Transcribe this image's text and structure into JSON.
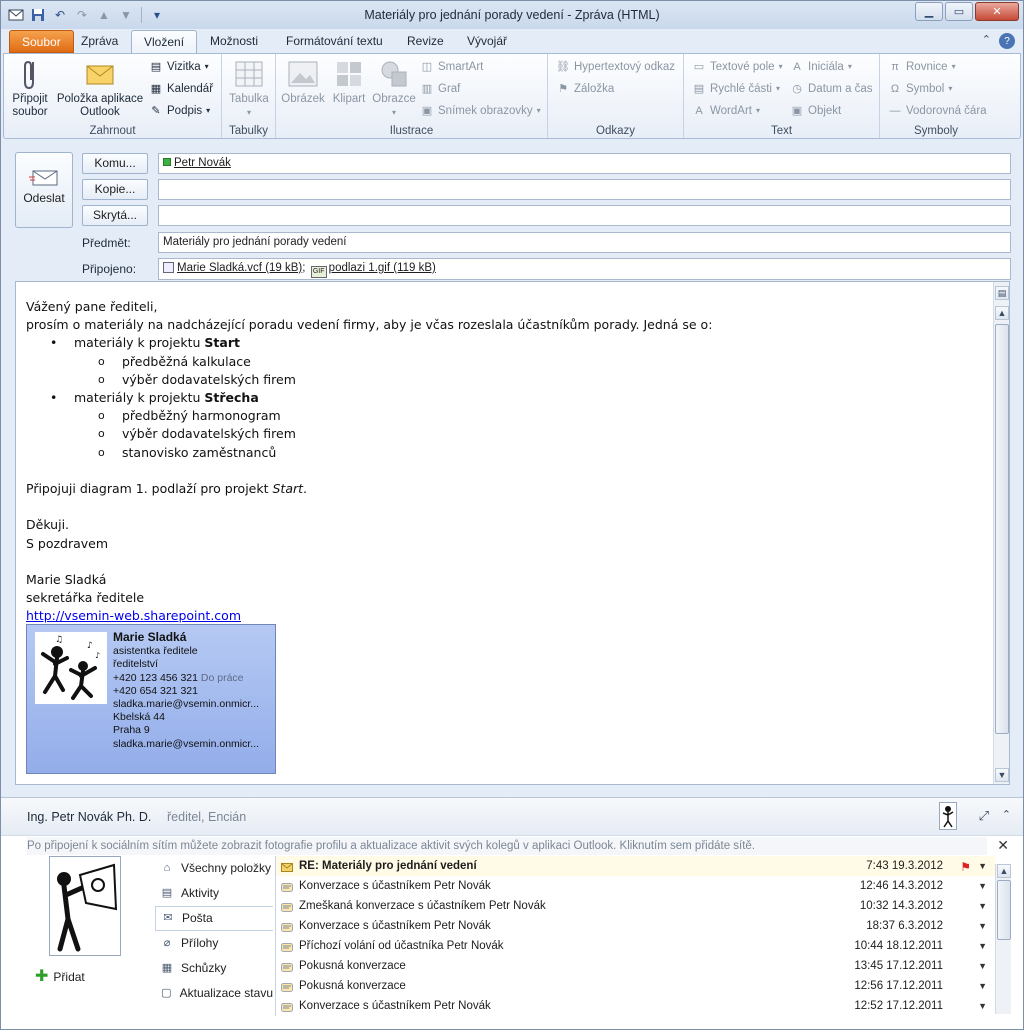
{
  "window": {
    "title": "Materiály pro jednání porady vedení  -  Zpráva (HTML)"
  },
  "tabs": [
    {
      "label": "Soubor"
    },
    {
      "label": "Zpráva"
    },
    {
      "label": "Vložení"
    },
    {
      "label": "Možnosti"
    },
    {
      "label": "Formátování textu"
    },
    {
      "label": "Revize"
    },
    {
      "label": "Vývojář"
    }
  ],
  "ribbon": {
    "zahrnout": {
      "label": "Zahrnout",
      "pripojit": "Připojit soubor",
      "polozka": "Položka aplikace Outlook",
      "vizitka": "Vizitka",
      "kalendar": "Kalendář",
      "podpis": "Podpis"
    },
    "tabulky": {
      "label": "Tabulky",
      "tabulka": "Tabulka"
    },
    "ilustrace": {
      "label": "Ilustrace",
      "obrazek": "Obrázek",
      "klipart": "Klipart",
      "obrazce": "Obrazce",
      "smartart": "SmartArt",
      "graf": "Graf",
      "snimek": "Snímek obrazovky"
    },
    "odkazy": {
      "label": "Odkazy",
      "hypertext": "Hypertextový odkaz",
      "zalozka": "Záložka"
    },
    "text": {
      "label": "Text",
      "textove_pole": "Textové pole",
      "rychle_casti": "Rychlé části",
      "wordart": "WordArt",
      "iniciala": "Iniciála",
      "datum": "Datum a čas",
      "objekt": "Objekt"
    },
    "symboly": {
      "label": "Symboly",
      "rovnice": "Rovnice",
      "symbol": "Symbol",
      "cara": "Vodorovná čára"
    }
  },
  "compose": {
    "send": "Odeslat",
    "to_btn": "Komu...",
    "cc_btn": "Kopie...",
    "bcc_btn": "Skrytá...",
    "to_value": "Petr Novák",
    "cc_value": "",
    "bcc_value": "",
    "subject_label": "Předmět:",
    "subject_value": "Materiály pro jednání porady vedení",
    "attached_label": "Připojeno:",
    "attachment1": "Marie Sladká.vcf (19 kB)",
    "attachment_sep": ";",
    "attachment2": "podlazi 1.gif (119 kB)"
  },
  "message": {
    "greeting": "Vážený pane řediteli,",
    "intro": "prosím o materiály na nadcházející poradu vedení firmy, aby je včas rozeslala účastníkům porady. Jedná se o:",
    "item1_prefix": "materiály k projektu ",
    "item1_bold": "Start",
    "item1_sub": [
      "předběžná kalkulace",
      "výběr dodavatelských firem"
    ],
    "item2_prefix": "materiály k projektu ",
    "item2_bold": "Střecha",
    "item2_sub": [
      "předběžný harmonogram",
      "výběr dodavatelských firem",
      "stanovisko zaměstnanců"
    ],
    "diagram_prefix": "Připojuji diagram 1. podlaží pro projekt ",
    "diagram_italic": "Start",
    "diagram_suffix": ".",
    "thanks": "Děkuji.",
    "regards": "S pozdravem",
    "sig_name": "Marie Sladká",
    "sig_title": "sekretářka ředitele",
    "sig_link": "http://vsemin-web.sharepoint.com"
  },
  "card": {
    "name": "Marie Sladká",
    "title": "asistentka ředitele",
    "dept": "ředitelství",
    "phone1": "+420 123 456 321",
    "phone1_label": "Do práce",
    "phone2": "+420 654 321 321",
    "email": "sladka.marie@vsemin.onmicr...",
    "street": "Kbelská 44",
    "city": "Praha 9",
    "email2": "sladka.marie@vsemin.onmicr..."
  },
  "people_pane": {
    "name": "Ing. Petr Novák Ph. D.",
    "role": "ředitel, Encián",
    "info": "Po připojení k sociálním sítím můžete zobrazit fotografie profilu a aktualizace aktivit svých kolegů v aplikaci Outlook. Kliknutím sem přidáte sítě.",
    "add": "Přidat",
    "nav": [
      {
        "label": "Všechny položky",
        "icon": "home-icon"
      },
      {
        "label": "Aktivity",
        "icon": "activity-icon"
      },
      {
        "label": "Pošta",
        "icon": "mail-icon"
      },
      {
        "label": "Přílohy",
        "icon": "paperclip-icon"
      },
      {
        "label": "Schůzky",
        "icon": "calendar-icon"
      },
      {
        "label": "Aktualizace stavu",
        "icon": "status-icon"
      }
    ],
    "items": [
      {
        "subject": "RE: Materiály pro jednání vedení",
        "date": "7:43 19.3.2012",
        "flag": true
      },
      {
        "subject": "Konverzace s účastníkem Petr Novák",
        "date": "12:46 14.3.2012",
        "flag": false
      },
      {
        "subject": "Zmeškaná konverzace s účastníkem Petr Novák",
        "date": "10:32 14.3.2012",
        "flag": false
      },
      {
        "subject": "Konverzace s účastníkem Petr Novák",
        "date": "18:37 6.3.2012",
        "flag": false
      },
      {
        "subject": "Příchozí volání od účastníka Petr Novák",
        "date": "10:44 18.12.2011",
        "flag": false
      },
      {
        "subject": "Pokusná konverzace",
        "date": "13:45 17.12.2011",
        "flag": false
      },
      {
        "subject": "Pokusná konverzace",
        "date": "12:56 17.12.2011",
        "flag": false
      },
      {
        "subject": "Konverzace s účastníkem Petr Novák",
        "date": "12:52 17.12.2011",
        "flag": false
      }
    ]
  },
  "colors": {
    "file_tab": "#e06b14",
    "link": "#0000ee",
    "card_bg": "#a8bff0",
    "flag": "#dd2222"
  }
}
